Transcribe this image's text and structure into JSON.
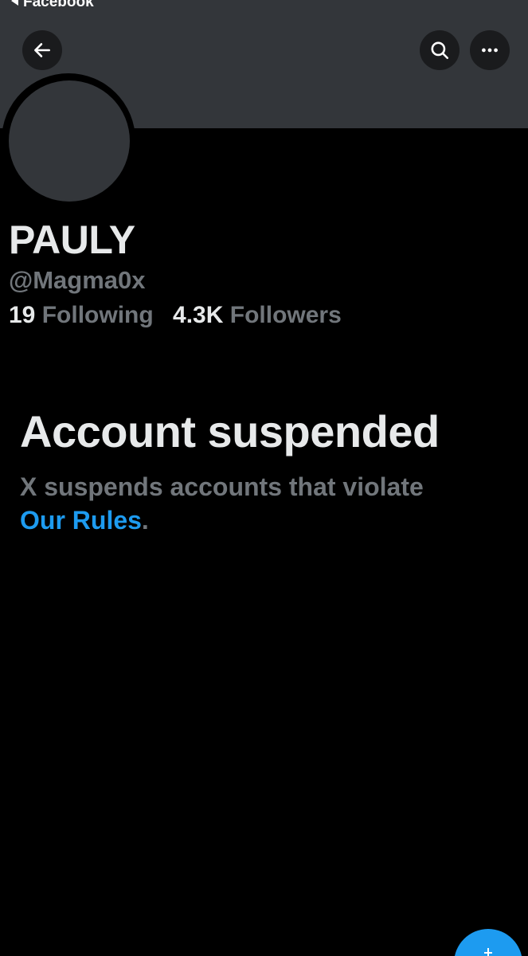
{
  "status_bar": {
    "back_app_label": "Facebook"
  },
  "header": {
    "back_icon": "arrow-left-icon",
    "search_icon": "search-icon",
    "more_icon": "more-horizontal-icon"
  },
  "profile": {
    "display_name": "PAULY",
    "handle": "@Magma0x",
    "following_count": "19",
    "following_label": "Following",
    "followers_count": "4.3K",
    "followers_label": "Followers"
  },
  "suspension": {
    "title": "Account suspended",
    "description": "X suspends accounts that violate",
    "rules_link": "Our Rules",
    "trailing_punct": "."
  },
  "fab": {
    "icon": "plus-icon"
  },
  "colors": {
    "background": "#000000",
    "banner": "#33363a",
    "primary_text": "#e7e9ea",
    "secondary_text": "#71767b",
    "link": "#1d9bf0",
    "fab": "#1d9bf0"
  }
}
